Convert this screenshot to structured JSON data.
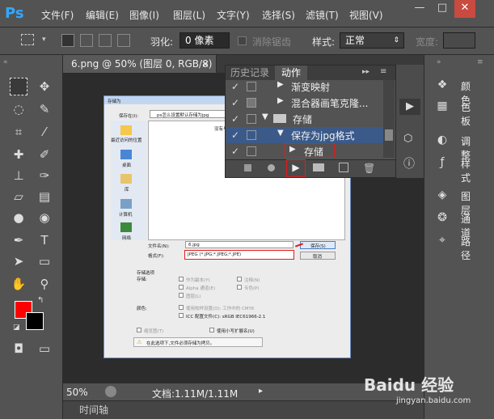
{
  "app": {
    "logo": "Ps",
    "menus": [
      "文件(F)",
      "编辑(E)",
      "图像(I)",
      "图层(L)",
      "文字(Y)",
      "选择(S)",
      "滤镜(T)",
      "视图(V)"
    ],
    "win": [
      "—",
      "□",
      "✕"
    ]
  },
  "options": {
    "feather_label": "羽化:",
    "feather_value": "0 像素",
    "antialias": "消除锯齿",
    "style_label": "样式:",
    "style_value": "正常",
    "width_label": "宽度:"
  },
  "document": {
    "tab": "6.png @ 50% (图层 0, RGB/8)",
    "tab_close": "×",
    "zoom": "50%",
    "doc_info": "文档:1.11M/1.11M",
    "timeline": "时间轴"
  },
  "panel": {
    "tabs": [
      "历史记录",
      "动作"
    ],
    "rows": [
      {
        "check": "✓",
        "label": "渐变映射",
        "indent": 1
      },
      {
        "check": "✓",
        "label": "混合器画笔克隆...",
        "indent": 1
      },
      {
        "check": "✓",
        "label": "存储",
        "indent": 0
      },
      {
        "check": "✓",
        "label": "保存为jpg格式",
        "indent": 1
      },
      {
        "check": "✓",
        "label": "存储",
        "indent": 2
      }
    ]
  },
  "right": {
    "items": [
      "颜色",
      "色板",
      "调整",
      "样式",
      "图层",
      "通道",
      "路径"
    ]
  },
  "dialog": {
    "title": "存储为",
    "save_in_label": "保存在(I):",
    "save_in_value": "ps怎么设置默认存储为jpg",
    "no_match": "没有与搜索条件匹配的项。",
    "places": [
      "最近访问的位置",
      "桌面",
      "库",
      "计算机",
      "网络"
    ],
    "filename_label": "文件名(N):",
    "filename_value": "6.jpg",
    "format_label": "格式(F):",
    "format_value": "JPEG (*.JPG;*.JPEG;*.JPE)",
    "save_button": "保存(S)",
    "cancel_button": "取消",
    "options_header": "存储选项",
    "store_label": "存储:",
    "opt_copy": "作为副本(Y)",
    "opt_notes": "注释(N)",
    "opt_alpha": "Alpha 通道(E)",
    "opt_spot": "专色(P)",
    "opt_layers": "图层(L)",
    "color_label": "颜色:",
    "opt_proof": "使用校样设置(O): 工作中的 CMYK",
    "opt_icc": "ICC 配置文件(C): sRGB IEC61966-2.1",
    "opt_thumb": "缩览图(T)",
    "opt_lower": "使用小写扩展名(U)",
    "warning": "在此选项下,文件必须存储为拷贝。"
  },
  "watermark": "Baidu 经验",
  "watermark_url": "jingyan.baidu.com",
  "colors": {
    "fg": "#ff0000",
    "bg": "#000000",
    "accent": "#31a8ff",
    "highlight": "#e31b1b"
  }
}
